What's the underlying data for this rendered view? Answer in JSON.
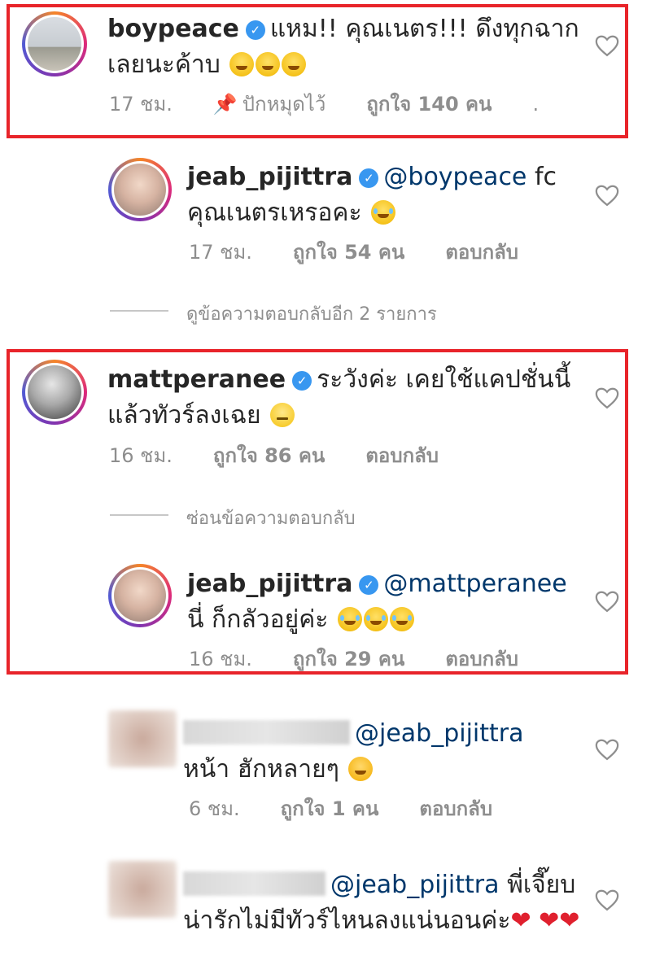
{
  "comments": [
    {
      "username": "boypeace",
      "text": "แหม!! คุณเนตร!!! ดึงทุกฉาก เลยนะค้าบ",
      "time": "17 ชม.",
      "pin": "ปักหมุดไว้",
      "likes": "ถูกใจ 140 คน",
      "more": "."
    },
    {
      "username": "jeab_pijittra",
      "mention": "@boypeace",
      "text": "fc คุณเนตรเหรอคะ",
      "time": "17 ชม.",
      "likes": "ถูกใจ 54 คน",
      "reply": "ตอบกลับ"
    },
    {
      "view_replies": "ดูข้อความตอบกลับอีก 2 รายการ"
    },
    {
      "username": "mattperanee",
      "text": "ระวังค่ะ เคยใช้แคปชั่นนี้ แล้วทัวร์ลงเฉย",
      "time": "16 ชม.",
      "likes": "ถูกใจ 86 คน",
      "reply": "ตอบกลับ"
    },
    {
      "hide_replies": "ซ่อนข้อความตอบกลับ"
    },
    {
      "username": "jeab_pijittra",
      "mention": "@mattperanee",
      "text": "นี่ ก็กลัวอยู่ค่ะ",
      "time": "16 ชม.",
      "likes": "ถูกใจ 29 คน",
      "reply": "ตอบกลับ"
    },
    {
      "mention": "@jeab_pijittra",
      "text": "หน้า ฮักหลายๆ",
      "time": "6 ชม.",
      "likes": "ถูกใจ 1 คน",
      "reply": "ตอบกลับ"
    },
    {
      "mention": "@jeab_pijittra",
      "text": "พี่เจี๊ยบ น่ารักไม่มีทัวร์ไหนลงแน่นอนค่ะ"
    }
  ],
  "colors": {
    "highlight": "#e8242a",
    "verified": "#3897f0",
    "mention": "#00376b",
    "meta": "#8e8e8e"
  },
  "icons": [
    "verified-badge-icon",
    "heart-outline-icon",
    "pin-icon",
    "laughing-emoji",
    "grinning-emoji",
    "neutral-emoji",
    "kiss-emoji",
    "red-heart-emoji"
  ]
}
